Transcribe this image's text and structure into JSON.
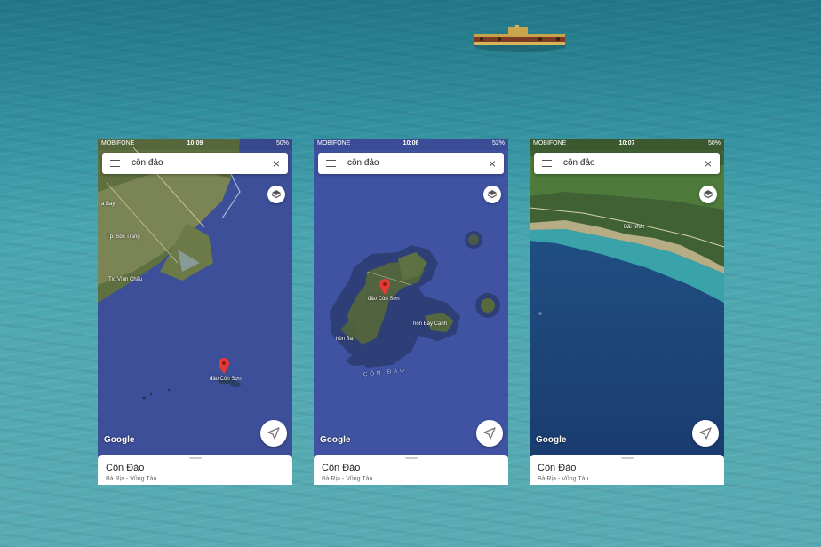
{
  "phones": [
    {
      "status": {
        "carrier": "MOBIFONE",
        "time": "10:09",
        "battery": "50%"
      },
      "search_text": "côn đảo",
      "map_labels": {
        "place_1": "a Bay",
        "place_2": "Tp. Sóc Trăng",
        "place_3": "Tx. Vĩnh Châu",
        "island": "đảo Côn Sơn"
      },
      "google_logo": "Google",
      "place_name": "Côn Đảo",
      "place_region": "Bà Rịa - Vũng Tàu"
    },
    {
      "status": {
        "carrier": "MOBIFONE",
        "time": "10:06",
        "battery": "52%"
      },
      "search_text": "côn đảo",
      "map_labels": {
        "island": "đảo Côn Sơn",
        "hon_ba": "hòn Ba",
        "hon_bay_canh": "hòn Bảy Cạnh",
        "archipelago": "CÔN ĐẢO"
      },
      "google_logo": "Google",
      "place_name": "Côn Đảo",
      "place_region": "Bà Rịa - Vũng Tàu"
    },
    {
      "status": {
        "carrier": "MOBIFONE",
        "time": "10:07",
        "battery": "50%"
      },
      "search_text": "côn đảo",
      "map_labels": {
        "beach": "Bãi Nhát"
      },
      "google_logo": "Google",
      "place_name": "Côn Đảo",
      "place_region": "Bà Rịa - Vũng Tàu"
    }
  ],
  "icons": {
    "menu": "menu-icon",
    "close": "close-icon",
    "layers": "layers-icon",
    "navigate": "navigation-arrow-icon",
    "pin": "map-pin-icon"
  },
  "colors": {
    "sea_background": "#3f9ea9",
    "map_ocean": "#3c4f9a",
    "pin_red": "#e53935",
    "satellite_land": "#4d6b3a"
  }
}
